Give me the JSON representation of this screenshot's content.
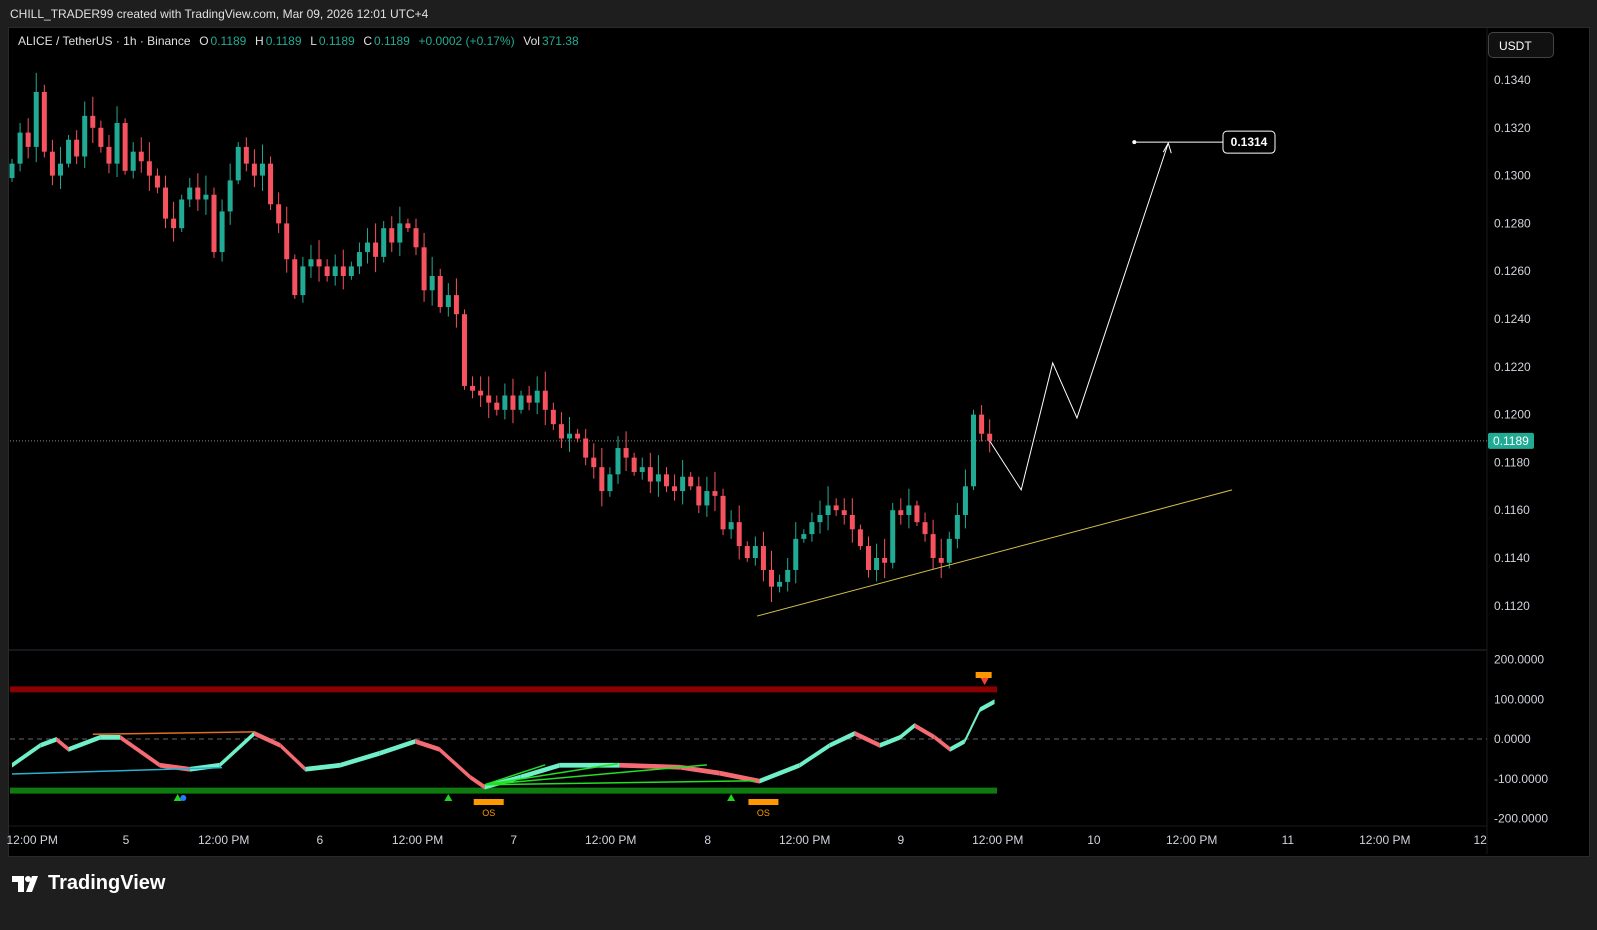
{
  "header": {
    "caption": "CHILL_TRADER99 created with TradingView.com, Mar 09, 2026 12:01 UTC+4"
  },
  "legend": {
    "symbol": "ALICE / TetherUS · 1h · Binance",
    "o_label": "O",
    "o": "0.1189",
    "h_label": "H",
    "h": "0.1189",
    "l_label": "L",
    "l": "0.1189",
    "c_label": "C",
    "c": "0.1189",
    "change": "+0.0002 (+0.17%)",
    "vol_label": "Vol",
    "vol": "371.38"
  },
  "unit_button": "USDT",
  "footer": {
    "brand": "TradingView"
  },
  "colors": {
    "bull": "#22ab94",
    "bear": "#f7525f",
    "trend": "#d4c24a",
    "projection": "#ffffff",
    "overbought": "#8b0000",
    "oversold": "#0f7a0f",
    "osc_up": "#6ff0c8",
    "osc_down": "#f56b73",
    "divergence": "#22e022",
    "os_marker": "#ff9800"
  },
  "chart_data": [
    {
      "type": "candlestick",
      "title": "ALICE / TetherUS 1h",
      "ylim": [
        0.111,
        0.1352
      ],
      "y_ticks": [
        "0.1340",
        "0.1320",
        "0.1300",
        "0.1280",
        "0.1260",
        "0.1240",
        "0.1220",
        "0.1200",
        "0.1180",
        "0.1160",
        "0.1140",
        "0.1120"
      ],
      "y_tick_values": [
        0.134,
        0.132,
        0.13,
        0.128,
        0.126,
        0.124,
        0.122,
        0.12,
        0.118,
        0.116,
        0.114,
        0.112
      ],
      "x_ticks": [
        "12:00 PM",
        "5",
        "12:00 PM",
        "6",
        "12:00 PM",
        "7",
        "12:00 PM",
        "8",
        "12:00 PM",
        "9",
        "12:00 PM",
        "10",
        "12:00 PM",
        "11",
        "12:00 PM",
        "12"
      ],
      "x_tick_index": [
        2.5,
        14.1,
        26.2,
        38.1,
        50.2,
        62.1,
        74.1,
        86.1,
        98.1,
        110,
        122,
        133.9,
        146,
        157.9,
        169.9,
        181.7
      ],
      "closes": [
        0.1305,
        0.1318,
        0.1312,
        0.1335,
        0.131,
        0.13,
        0.1305,
        0.1315,
        0.1308,
        0.1325,
        0.132,
        0.1312,
        0.1305,
        0.1322,
        0.1302,
        0.131,
        0.1306,
        0.13,
        0.1295,
        0.1282,
        0.1278,
        0.129,
        0.1295,
        0.129,
        0.1292,
        0.1268,
        0.1285,
        0.1298,
        0.1312,
        0.1305,
        0.13,
        0.1305,
        0.1288,
        0.128,
        0.1265,
        0.125,
        0.1262,
        0.1265,
        0.1262,
        0.1258,
        0.1262,
        0.1258,
        0.1262,
        0.1268,
        0.1272,
        0.1266,
        0.1278,
        0.1272,
        0.128,
        0.1278,
        0.127,
        0.1252,
        0.1258,
        0.1245,
        0.125,
        0.1242,
        0.1212,
        0.121,
        0.1208,
        0.1205,
        0.1202,
        0.1208,
        0.1202,
        0.1208,
        0.1205,
        0.121,
        0.1202,
        0.1196,
        0.119,
        0.1192,
        0.119,
        0.1182,
        0.1178,
        0.1168,
        0.1175,
        0.1186,
        0.1182,
        0.1176,
        0.1178,
        0.1172,
        0.1175,
        0.117,
        0.1168,
        0.1174,
        0.117,
        0.1162,
        0.1168,
        0.1166,
        0.1152,
        0.1155,
        0.1145,
        0.114,
        0.1145,
        0.1135,
        0.1128,
        0.113,
        0.1135,
        0.1148,
        0.115,
        0.1155,
        0.1158,
        0.1162,
        0.116,
        0.1158,
        0.1152,
        0.1145,
        0.1135,
        0.114,
        0.1138,
        0.116,
        0.1158,
        0.1162,
        0.1155,
        0.115,
        0.114,
        0.1138,
        0.1148,
        0.1158,
        0.117,
        0.12,
        0.1192,
        0.1189
      ],
      "last_price": "0.1189",
      "last_price_value": 0.1189,
      "annotations": {
        "trendline": [
          [
            92.2,
            0.11157
          ],
          [
            151,
            0.11685
          ]
        ],
        "projection_path": [
          [
            121,
            0.1189
          ],
          [
            124.9,
            0.11685
          ],
          [
            128.8,
            0.12216
          ],
          [
            131.8,
            0.11986
          ],
          [
            143.1,
            0.13136
          ]
        ],
        "target_line": [
          [
            138.9,
            0.1314
          ],
          [
            149.9,
            0.1314
          ]
        ],
        "target_label": "0.1314",
        "target_value": 0.1314
      }
    },
    {
      "type": "line",
      "title": "Oscillator",
      "ylim": [
        -200,
        200
      ],
      "y_ticks": [
        "200.0000",
        "100.0000",
        "0.0000",
        "-100.0000",
        "-200.0000"
      ],
      "y_tick_values": [
        200,
        100,
        0,
        -100,
        -200
      ],
      "overbought": 125,
      "oversold": -130,
      "series": [
        [
          0,
          -60
        ],
        [
          3.5,
          -10
        ],
        [
          5.5,
          5
        ],
        [
          7,
          -20
        ],
        [
          10.9,
          10
        ],
        [
          13.4,
          10
        ],
        [
          18.3,
          -60
        ],
        [
          22,
          -70
        ],
        [
          25.7,
          -60
        ],
        [
          30,
          20
        ],
        [
          33.2,
          -10
        ],
        [
          36.3,
          -70
        ],
        [
          40.6,
          -60
        ],
        [
          45.5,
          -30
        ],
        [
          49.9,
          0
        ],
        [
          52.9,
          -20
        ],
        [
          56.7,
          -90
        ],
        [
          58.5,
          -115
        ],
        [
          62.9,
          -90
        ],
        [
          67.8,
          -60
        ],
        [
          75.2,
          -60
        ],
        [
          82.7,
          -65
        ],
        [
          87.6,
          -80
        ],
        [
          92.5,
          -100
        ],
        [
          97.5,
          -60
        ],
        [
          101.2,
          -10
        ],
        [
          104.3,
          20
        ],
        [
          107.4,
          -10
        ],
        [
          109.9,
          10
        ],
        [
          111.7,
          40
        ],
        [
          114.2,
          10
        ],
        [
          116.1,
          -20
        ],
        [
          117.9,
          0
        ],
        [
          119.8,
          80
        ],
        [
          121.6,
          100
        ]
      ],
      "buy_signals": [
        20.5,
        54,
        89
      ],
      "os_labels": [
        {
          "index": 59,
          "text": "OS"
        },
        {
          "index": 93,
          "text": "OS"
        }
      ],
      "ob_marker_index": 120.5
    }
  ]
}
